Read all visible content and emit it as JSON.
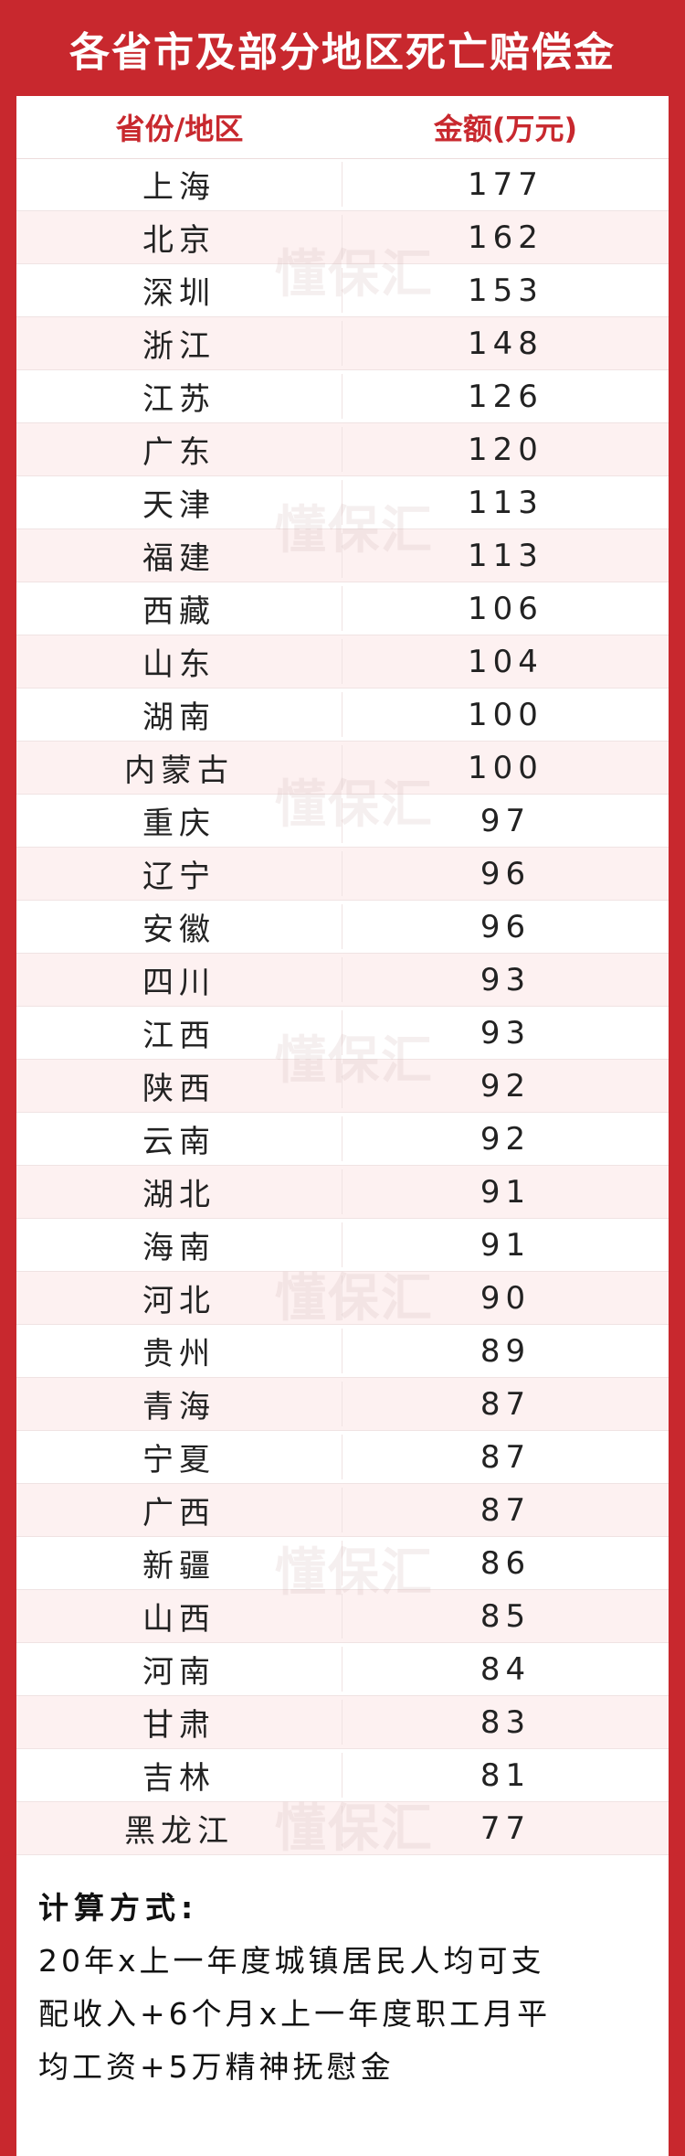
{
  "title": "各省市及部分地区死亡赔偿金",
  "table": {
    "col_region": "省份/地区",
    "col_amount": "金额(万元)",
    "rows": [
      {
        "region": "上海",
        "amount": "177"
      },
      {
        "region": "北京",
        "amount": "162"
      },
      {
        "region": "深圳",
        "amount": "153"
      },
      {
        "region": "浙江",
        "amount": "148"
      },
      {
        "region": "江苏",
        "amount": "126"
      },
      {
        "region": "广东",
        "amount": "120"
      },
      {
        "region": "天津",
        "amount": "113"
      },
      {
        "region": "福建",
        "amount": "113"
      },
      {
        "region": "西藏",
        "amount": "106"
      },
      {
        "region": "山东",
        "amount": "104"
      },
      {
        "region": "湖南",
        "amount": "100"
      },
      {
        "region": "内蒙古",
        "amount": "100"
      },
      {
        "region": "重庆",
        "amount": "97"
      },
      {
        "region": "辽宁",
        "amount": "96"
      },
      {
        "region": "安徽",
        "amount": "96"
      },
      {
        "region": "四川",
        "amount": "93"
      },
      {
        "region": "江西",
        "amount": "93"
      },
      {
        "region": "陕西",
        "amount": "92"
      },
      {
        "region": "云南",
        "amount": "92"
      },
      {
        "region": "湖北",
        "amount": "91"
      },
      {
        "region": "海南",
        "amount": "91"
      },
      {
        "region": "河北",
        "amount": "90"
      },
      {
        "region": "贵州",
        "amount": "89"
      },
      {
        "region": "青海",
        "amount": "87"
      },
      {
        "region": "宁夏",
        "amount": "87"
      },
      {
        "region": "广西",
        "amount": "87"
      },
      {
        "region": "新疆",
        "amount": "86"
      },
      {
        "region": "山西",
        "amount": "85"
      },
      {
        "region": "河南",
        "amount": "84"
      },
      {
        "region": "甘肃",
        "amount": "83"
      },
      {
        "region": "吉林",
        "amount": "81"
      },
      {
        "region": "黑龙江",
        "amount": "77"
      }
    ]
  },
  "watermark": "懂保汇",
  "formula": {
    "heading": "计算方式:",
    "line1": "20年x上一年度城镇居民人均可支",
    "line2": "配收入+6个月x上一年度职工月平",
    "line3": "均工资+5万精神抚慰金"
  },
  "colors": {
    "brand_red": "#c8282e",
    "stripe": "#fdf1f1"
  }
}
